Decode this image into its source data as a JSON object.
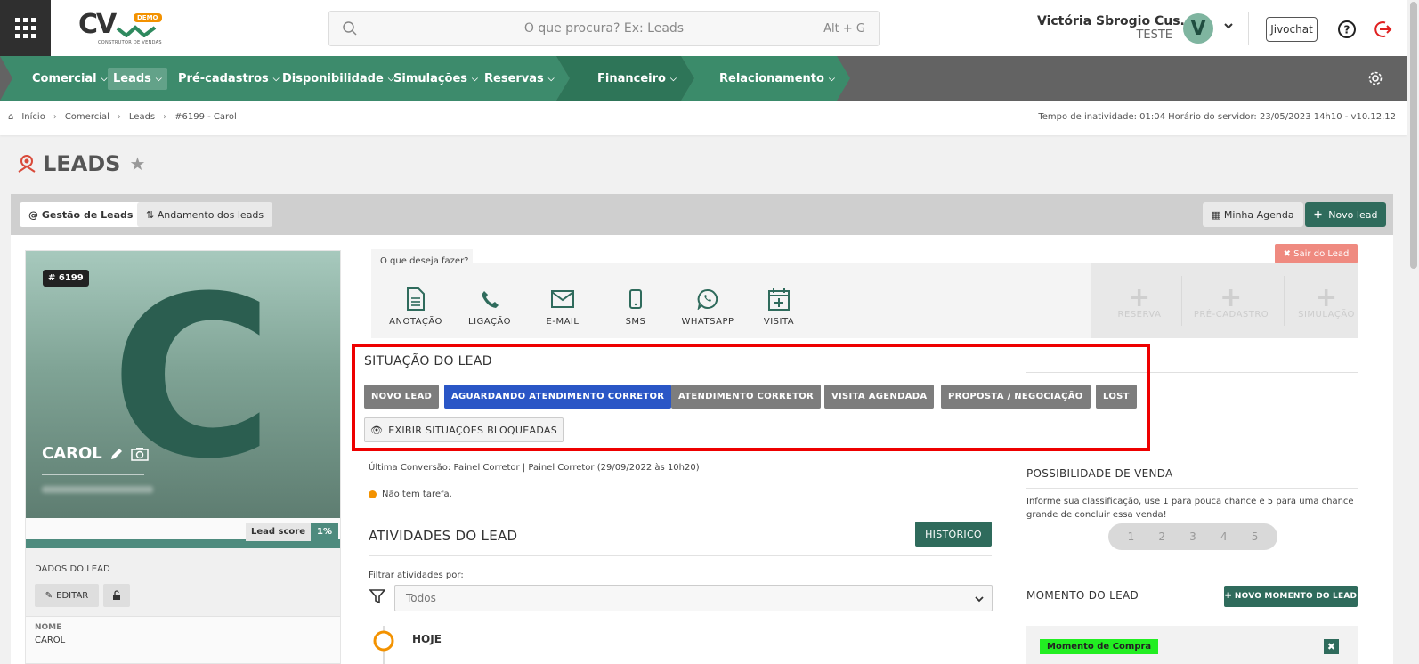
{
  "header": {
    "logo_text": "CV",
    "logo_badge": "DEMO",
    "logo_sub": "CONSTRUTOR DE VENDAS",
    "search_placeholder": "O que procura? Ex: Leads",
    "search_shortcut": "Alt + G",
    "user_name": "Victória Sbrogio Cus...",
    "user_role": "TESTE",
    "avatar_letter": "V",
    "jivochat_label": "Jivochat"
  },
  "nav": {
    "items": [
      {
        "label": "Comercial"
      },
      {
        "label": "Leads"
      },
      {
        "label": "Pré-cadastros"
      },
      {
        "label": "Disponibilidade"
      },
      {
        "label": "Simulações"
      },
      {
        "label": "Reservas"
      },
      {
        "label": "Financeiro"
      },
      {
        "label": "Relacionamento"
      }
    ],
    "active": "Leads"
  },
  "breadcrumb": {
    "items": [
      "Início",
      "Comercial",
      "Leads",
      "#6199 - Carol"
    ],
    "server_info": "Tempo de inatividade: 01:04   Horário do servidor: 23/05/2023 14h10 - v10.12.12"
  },
  "page": {
    "title": "LEADS"
  },
  "toolbar": {
    "tab_gestao": "Gestão de Leads",
    "tab_andamento": "Andamento dos leads",
    "btn_agenda": "Minha Agenda",
    "btn_novo": "Novo lead"
  },
  "lead": {
    "id_badge": "# 6199",
    "initial": "C",
    "name": "CAROL",
    "score_label": "Lead score",
    "score_value": "1%",
    "dados_title": "DADOS DO LEAD",
    "edit_label": "EDITAR",
    "nome_label": "NOME",
    "nome_value": "CAROL"
  },
  "actions": {
    "prompt": "O que deseja fazer?",
    "items": [
      "ANOTAÇÃO",
      "LIGAÇÃO",
      "E-MAIL",
      "SMS",
      "WHATSAPP",
      "VISITA"
    ],
    "right_items": [
      "RESERVA",
      "PRÉ-CADASTRO",
      "SIMULAÇÃO"
    ],
    "sair_label": "Sair do Lead"
  },
  "situacao": {
    "title": "SITUAÇÃO DO LEAD",
    "statuses": [
      "NOVO LEAD",
      "AGUARDANDO ATENDIMENTO CORRETOR",
      "ATENDIMENTO CORRETOR",
      "VISITA AGENDADA",
      "PROPOSTA / NEGOCIAÇÃO",
      "LOST"
    ],
    "active": "AGUARDANDO ATENDIMENTO CORRETOR",
    "exibir_label": "EXIBIR SITUAÇÕES BLOQUEADAS"
  },
  "info": {
    "ultima_conversao": "Última Conversão: Painel Corretor | Painel Corretor (29/09/2022 às 10h20)",
    "tarefa": "Não tem tarefa."
  },
  "atividades": {
    "title": "ATIVIDADES DO LEAD",
    "historico_label": "HISTÓRICO",
    "filtro_label": "Filtrar atividades por:",
    "filtro_value": "Todos",
    "hoje_label": "HOJE"
  },
  "possibilidade": {
    "title": "POSSIBILIDADE DE VENDA",
    "desc": "Informe sua classificação, use 1 para pouca chance e 5 para uma chance grande de concluir essa venda!",
    "ratings": [
      "1",
      "2",
      "3",
      "4",
      "5"
    ]
  },
  "momento": {
    "title": "MOMENTO DO LEAD",
    "novo_label": "NOVO MOMENTO DO LEAD",
    "badge": "Momento de Compra"
  }
}
